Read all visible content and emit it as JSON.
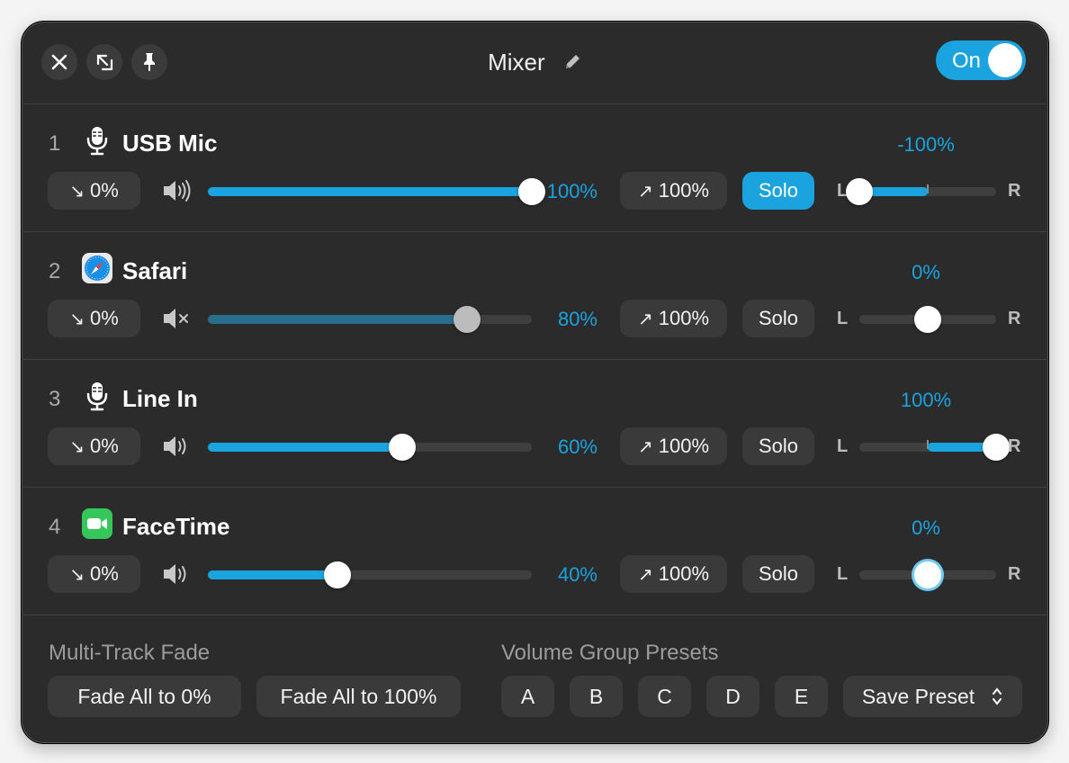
{
  "window": {
    "title": "Mixer",
    "power_toggle": "On",
    "accent_color": "#1aa3de"
  },
  "tracks": [
    {
      "number": "1",
      "name": "USB Mic",
      "icon": "microphone-icon",
      "fade_in": "0%",
      "volume_label": "100%",
      "volume": 1.0,
      "fade_out": "100%",
      "solo_label": "Solo",
      "solo_active": true,
      "pan_label": "-100%",
      "pan": -1.0,
      "muted": false,
      "L": "L",
      "R": "R"
    },
    {
      "number": "2",
      "name": "Safari",
      "icon": "safari-compass-icon",
      "fade_in": "0%",
      "volume_label": "80%",
      "volume": 0.8,
      "fade_out": "100%",
      "solo_label": "Solo",
      "solo_active": false,
      "pan_label": "0%",
      "pan": 0.0,
      "muted": true,
      "L": "L",
      "R": "R"
    },
    {
      "number": "3",
      "name": "Line In",
      "icon": "microphone-icon",
      "fade_in": "0%",
      "volume_label": "60%",
      "volume": 0.6,
      "fade_out": "100%",
      "solo_label": "Solo",
      "solo_active": false,
      "pan_label": "100%",
      "pan": 1.0,
      "muted": false,
      "L": "L",
      "R": "R"
    },
    {
      "number": "4",
      "name": "FaceTime",
      "icon": "facetime-camera-icon",
      "fade_in": "0%",
      "volume_label": "40%",
      "volume": 0.4,
      "fade_out": "100%",
      "solo_label": "Solo",
      "solo_active": false,
      "pan_label": "0%",
      "pan": 0.0,
      "muted": false,
      "L": "L",
      "R": "R"
    }
  ],
  "footer": {
    "multi_track_label": "Multi-Track Fade",
    "fade_all_zero": "Fade All to 0%",
    "fade_all_full": "Fade All to 100%",
    "presets_label": "Volume Group Presets",
    "presets": [
      "A",
      "B",
      "C",
      "D",
      "E"
    ],
    "save_preset": "Save Preset"
  }
}
